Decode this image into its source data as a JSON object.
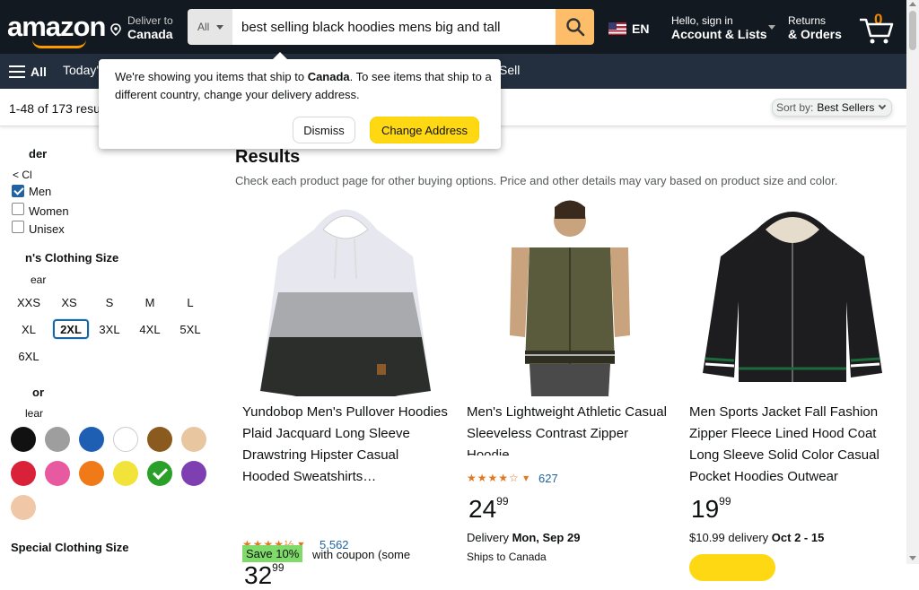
{
  "header": {
    "deliver_small": "Deliver to",
    "deliver_big": "Canada",
    "search_category": "All",
    "search_value": "best selling black hoodies mens big and tall",
    "language": "EN",
    "account_small": "Hello, sign in",
    "account_big": "Account & Lists",
    "returns_small": "Returns",
    "returns_big": "& Orders",
    "cart_count": "0",
    "search_button_icon": "search-icon",
    "cart_icon": "cart-icon"
  },
  "subnav": {
    "all_label": "All",
    "todays_deals": "Today's",
    "sell": "Sell"
  },
  "popover": {
    "text_1": "We're showing you items that ship to ",
    "country": "Canada",
    "text_2": ". To see items that ship to a different country, change your delivery address.",
    "dismiss": "Dismiss",
    "change_address": "Change Address"
  },
  "results_bar": {
    "count": "1-48 of 173 resu",
    "sort_label": "Sort by:",
    "sort_value": "Best Sellers"
  },
  "sidebar": {
    "gender_heading": "der",
    "gender_clear": "< Cl",
    "gender_options": [
      {
        "label": "Men",
        "checked": true
      },
      {
        "label": "Women",
        "checked": false
      },
      {
        "label": "Unisex",
        "checked": false
      }
    ],
    "size_heading": "n's Clothing Size",
    "size_clear": "ear",
    "sizes": [
      "XXS",
      "XS",
      "S",
      "M",
      "L",
      "XL",
      "2XL",
      "3XL",
      "4XL",
      "5XL",
      "6XL"
    ],
    "selected_size": "2XL",
    "color_heading": "or",
    "color_clear": "lear",
    "colors": [
      "#111111",
      "#9e9e9e",
      "#1e5fb3",
      "#ffffff",
      "#8b5a1e",
      "#e8c6a0",
      "#d9213a",
      "#e85aa0",
      "#f07a18",
      "#f2e33a",
      "#2aa02a",
      "#7e3fb0",
      "#f0c8a8"
    ],
    "special_size_heading": "Special Clothing Size"
  },
  "main": {
    "title": "Results",
    "subtitle": "Check each product page for other buying options. Price and other details may vary based on product size and color."
  },
  "products": [
    {
      "title": "Yundobop Men's Pullover Hoodies Plaid Jacquard Long Sleeve Drawstring Hipster Casual Hooded Sweatshirts…",
      "rating": "4.5",
      "reviews": "5,562",
      "price_whole": "32",
      "price_frac": "99",
      "coupon": "Save 10%",
      "coupon_note": "with coupon (some"
    },
    {
      "title": "Men's Lightweight Athletic Casual Sleeveless Contrast Zipper Hoodie",
      "rating": "4.3",
      "reviews": "627",
      "price_whole": "24",
      "price_frac": "99",
      "delivery_label": "Delivery ",
      "delivery_date": "Mon, Sep 29",
      "ships_to": "Ships to Canada"
    },
    {
      "title": "Men Sports Jacket Fall Fashion Zipper Fleece Lined Hood Coat Long Sleeve Solid Color Casual Pocket Hoodies Outwear",
      "price_whole": "19",
      "price_frac": "99",
      "delivery_label": "$10.99 delivery ",
      "delivery_date": "Oct 2 - 15"
    }
  ]
}
